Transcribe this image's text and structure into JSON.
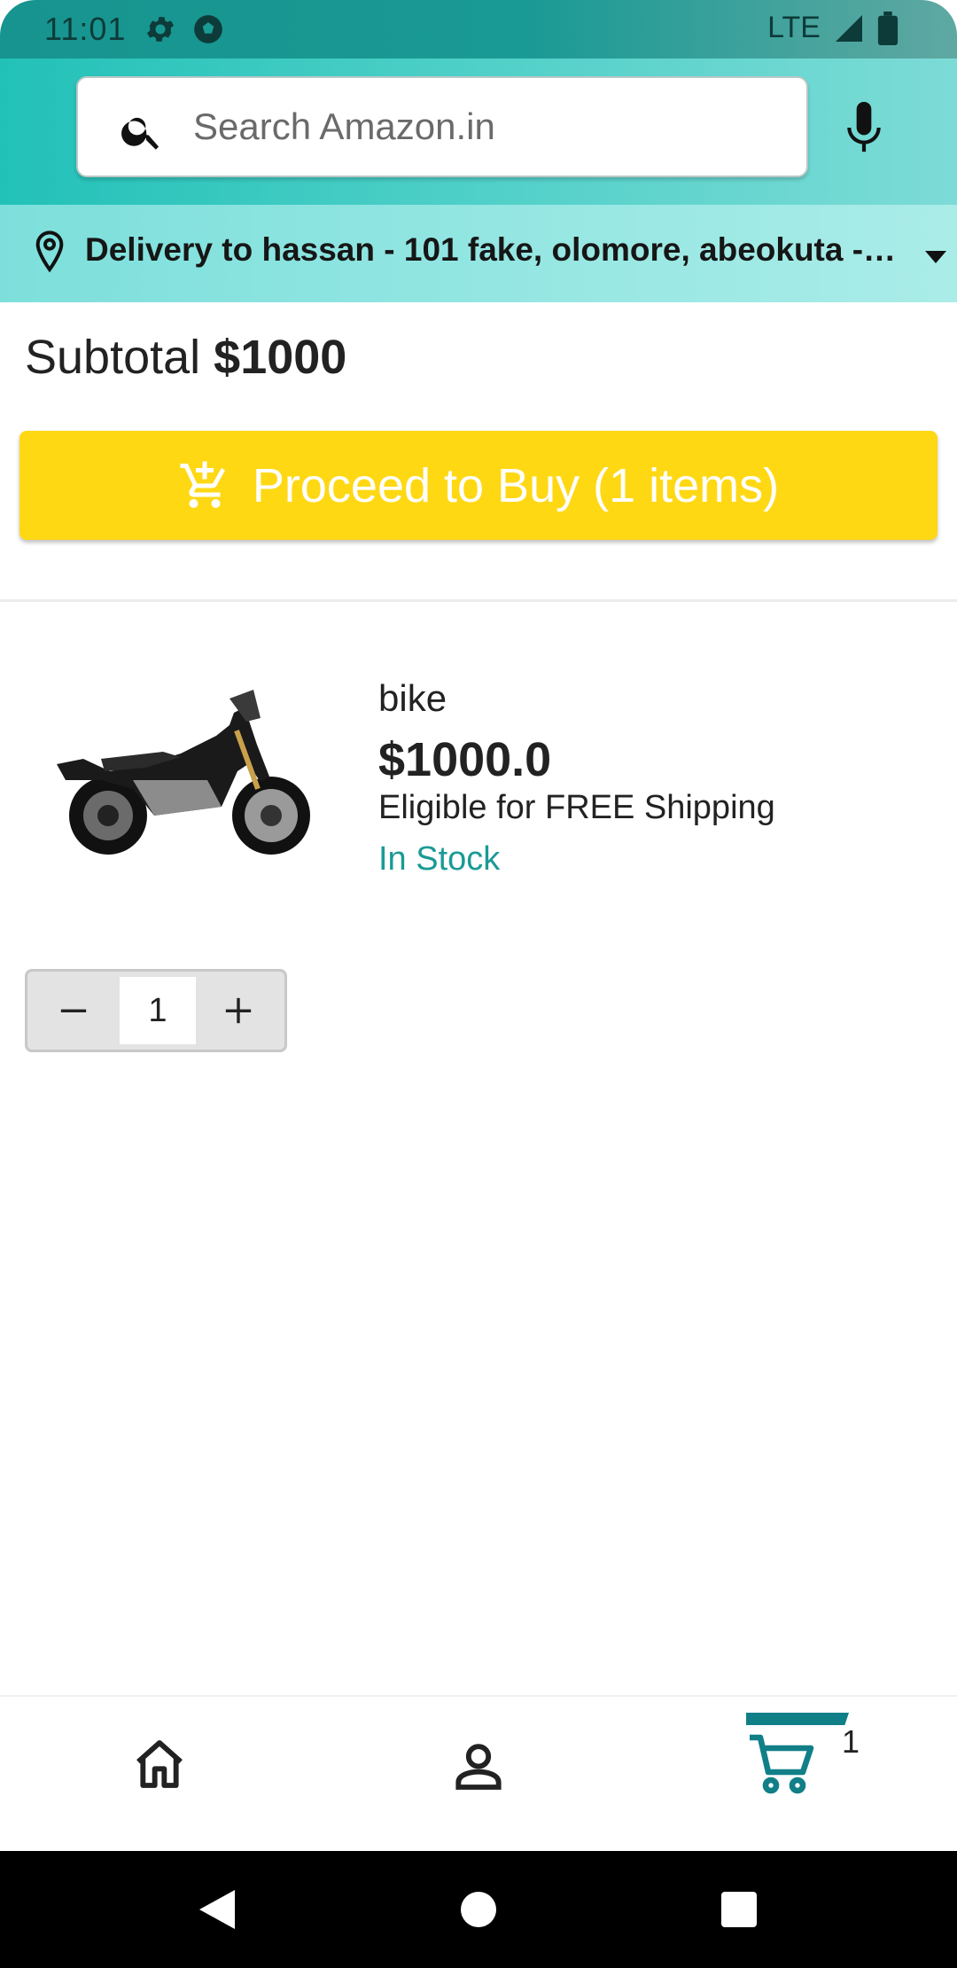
{
  "status_bar": {
    "time": "11:01",
    "network": "LTE",
    "icons_left": [
      "settings-icon",
      "soccer-ball-icon"
    ],
    "icons_right": [
      "signal-icon",
      "battery-icon"
    ]
  },
  "header": {
    "search_placeholder": "Search Amazon.in",
    "icons": [
      "search-icon",
      "mic-icon"
    ]
  },
  "delivery": {
    "text": "Delivery to hassan - 101 fake, olomore, abeokuta - 1…",
    "icons": [
      "location-pin-icon",
      "dropdown-arrow-icon"
    ]
  },
  "cart": {
    "subtotal_label": "Subtotal ",
    "subtotal_amount": "$1000",
    "proceed_label": "Proceed to Buy (1 items)",
    "items": [
      {
        "name": "bike",
        "price": "$1000.0",
        "shipping": "Eligible for FREE Shipping",
        "stock": "In Stock",
        "quantity": "1"
      }
    ]
  },
  "bottom_nav": {
    "items": [
      "home-icon",
      "account-icon",
      "cart-icon"
    ],
    "active": "cart",
    "cart_badge": "1"
  },
  "colors": {
    "accent": "#1a9a95",
    "header_start": "#22c1b8",
    "button": "#ffd814",
    "active_nav": "#117f88"
  }
}
